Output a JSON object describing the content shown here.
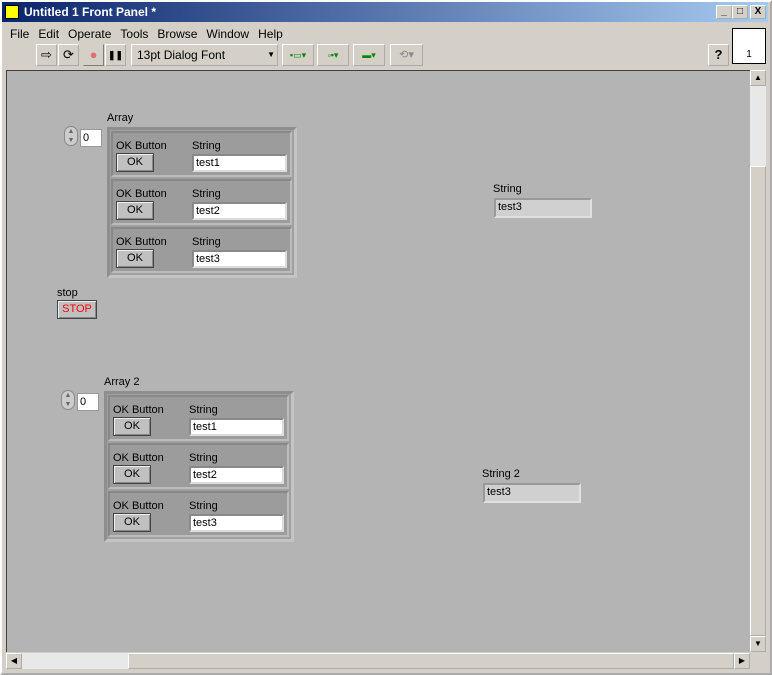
{
  "window": {
    "title": "Untitled 1 Front Panel *",
    "min": "_",
    "max": "□",
    "close": "X"
  },
  "menu": [
    "File",
    "Edit",
    "Operate",
    "Tools",
    "Browse",
    "Window",
    "Help"
  ],
  "toolbar": {
    "run": "⇨",
    "run_cont": "⟳",
    "abort": "●",
    "pause": "❚❚",
    "font": "13pt Dialog Font",
    "help": "?",
    "connector_num": "1"
  },
  "array1": {
    "label": "Array",
    "index": "0",
    "elements": [
      {
        "button_label": "OK Button",
        "button_text": "OK",
        "string_label": "String",
        "value": "test1"
      },
      {
        "button_label": "OK Button",
        "button_text": "OK",
        "string_label": "String",
        "value": "test2"
      },
      {
        "button_label": "OK Button",
        "button_text": "OK",
        "string_label": "String",
        "value": "test3"
      }
    ]
  },
  "array2": {
    "label": "Array 2",
    "index": "0",
    "elements": [
      {
        "button_label": "OK Button",
        "button_text": "OK",
        "string_label": "String",
        "value": "test1"
      },
      {
        "button_label": "OK Button",
        "button_text": "OK",
        "string_label": "String",
        "value": "test2"
      },
      {
        "button_label": "OK Button",
        "button_text": "OK",
        "string_label": "String",
        "value": "test3"
      }
    ]
  },
  "stop": {
    "label": "stop",
    "text": "STOP"
  },
  "string1": {
    "label": "String",
    "value": "test3"
  },
  "string2": {
    "label": "String 2",
    "value": "test3"
  }
}
